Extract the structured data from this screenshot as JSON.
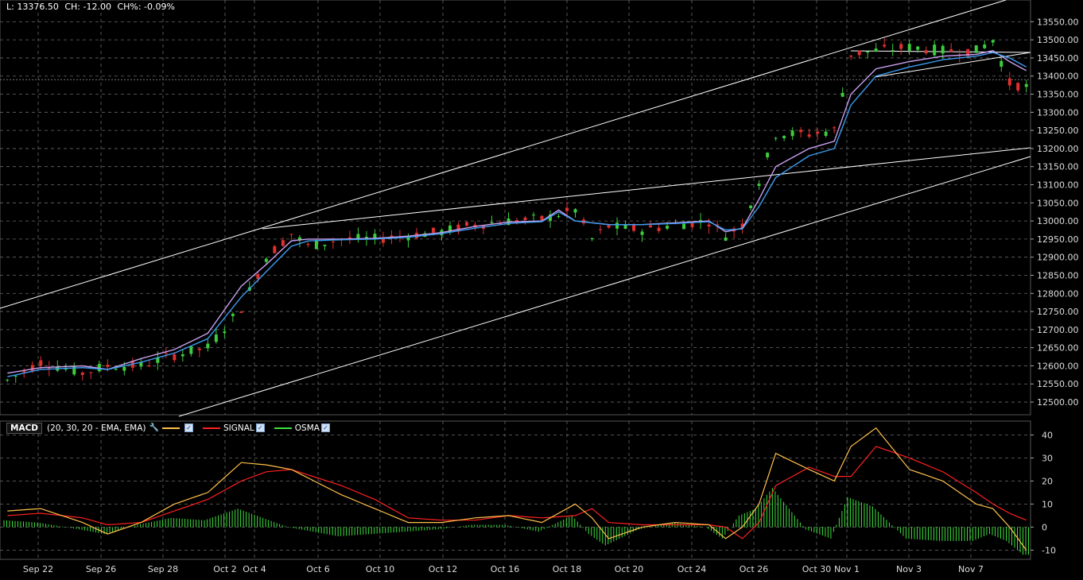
{
  "header": {
    "last_label": "L: 13376.50",
    "change_label": "CH: -12.00",
    "change_pct_label": "CH%: -0.09%"
  },
  "macd_legend": {
    "title": "MACD",
    "params": "(20, 30, 20 - EMA, EMA)",
    "signal_label": "SIGNAL",
    "osma_label": "OSMA",
    "macd_color": "#ffc04a",
    "signal_color": "#ff2020",
    "osma_color": "#3de03d"
  },
  "colors": {
    "background": "#000000",
    "grid": "#6a6a6a",
    "candle_up": "#3ccc3c",
    "candle_down": "#e03030",
    "ema_fast": "#c8a0f0",
    "ema_slow": "#3c9cf0",
    "trendline": "#ffffff"
  },
  "x_labels": [
    "Sep 22",
    "Sep 26",
    "Sep 28",
    "Oct 2",
    "Oct 4",
    "Oct 6",
    "Oct 10",
    "Oct 12",
    "Oct 16",
    "Oct 18",
    "Oct 20",
    "Oct 24",
    "Oct 26",
    "Oct 30",
    "Nov 1",
    "Nov 3",
    "Nov 7"
  ],
  "chart_data": [
    {
      "type": "candlestick",
      "title": "",
      "y_ticks": [
        12500,
        12550,
        12600,
        12650,
        12700,
        12750,
        12800,
        12850,
        12900,
        12950,
        13000,
        13050,
        13100,
        13150,
        13200,
        13250,
        13300,
        13350,
        13400,
        13450,
        13500,
        13550
      ],
      "ylim": [
        12465,
        13610
      ],
      "current_price_line": 13390,
      "price_path": [
        [
          0,
          12560
        ],
        [
          4,
          12610
        ],
        [
          9,
          12580
        ],
        [
          12,
          12600
        ],
        [
          16,
          12600
        ],
        [
          20,
          12630
        ],
        [
          24,
          12650
        ],
        [
          28,
          12760
        ],
        [
          31,
          12900
        ],
        [
          34,
          12965
        ],
        [
          36,
          12930
        ],
        [
          40,
          12950
        ],
        [
          44,
          12950
        ],
        [
          48,
          12960
        ],
        [
          52,
          12970
        ],
        [
          56,
          12990
        ],
        [
          60,
          13000
        ],
        [
          64,
          13005
        ],
        [
          68,
          13030
        ],
        [
          70,
          12950
        ],
        [
          72,
          12985
        ],
        [
          76,
          12975
        ],
        [
          80,
          12990
        ],
        [
          84,
          13000
        ],
        [
          86,
          12960
        ],
        [
          88,
          12990
        ],
        [
          90,
          13110
        ],
        [
          92,
          13240
        ],
        [
          96,
          13240
        ],
        [
          99,
          13250
        ],
        [
          101,
          13460
        ],
        [
          104,
          13470
        ],
        [
          108,
          13480
        ],
        [
          112,
          13470
        ],
        [
          116,
          13470
        ],
        [
          118,
          13500
        ],
        [
          120,
          13380
        ],
        [
          122,
          13370
        ]
      ],
      "ema_fast_path": [
        [
          0,
          12580
        ],
        [
          4,
          12595
        ],
        [
          9,
          12600
        ],
        [
          12,
          12590
        ],
        [
          16,
          12620
        ],
        [
          20,
          12645
        ],
        [
          24,
          12690
        ],
        [
          28,
          12820
        ],
        [
          31,
          12880
        ],
        [
          34,
          12945
        ],
        [
          36,
          12950
        ],
        [
          40,
          12950
        ],
        [
          44,
          12952
        ],
        [
          48,
          12958
        ],
        [
          52,
          12968
        ],
        [
          56,
          12985
        ],
        [
          60,
          12997
        ],
        [
          64,
          13000
        ],
        [
          66,
          13030
        ],
        [
          68,
          13000
        ],
        [
          72,
          12990
        ],
        [
          76,
          12990
        ],
        [
          80,
          12995
        ],
        [
          84,
          13000
        ],
        [
          86,
          12970
        ],
        [
          88,
          12980
        ],
        [
          90,
          13060
        ],
        [
          92,
          13150
        ],
        [
          96,
          13200
        ],
        [
          99,
          13220
        ],
        [
          101,
          13350
        ],
        [
          104,
          13420
        ],
        [
          108,
          13440
        ],
        [
          112,
          13455
        ],
        [
          116,
          13460
        ],
        [
          118,
          13470
        ],
        [
          120,
          13440
        ],
        [
          122,
          13415
        ]
      ],
      "ema_slow_path": [
        [
          0,
          12570
        ],
        [
          4,
          12590
        ],
        [
          9,
          12595
        ],
        [
          12,
          12590
        ],
        [
          16,
          12610
        ],
        [
          20,
          12635
        ],
        [
          24,
          12675
        ],
        [
          28,
          12790
        ],
        [
          31,
          12860
        ],
        [
          34,
          12930
        ],
        [
          36,
          12945
        ],
        [
          40,
          12948
        ],
        [
          44,
          12950
        ],
        [
          48,
          12955
        ],
        [
          52,
          12965
        ],
        [
          56,
          12980
        ],
        [
          60,
          12993
        ],
        [
          64,
          12998
        ],
        [
          66,
          13025
        ],
        [
          68,
          13000
        ],
        [
          72,
          12990
        ],
        [
          76,
          12990
        ],
        [
          80,
          12993
        ],
        [
          84,
          12998
        ],
        [
          86,
          12975
        ],
        [
          88,
          12978
        ],
        [
          90,
          13040
        ],
        [
          92,
          13120
        ],
        [
          96,
          13180
        ],
        [
          99,
          13200
        ],
        [
          101,
          13320
        ],
        [
          104,
          13400
        ],
        [
          108,
          13425
        ],
        [
          112,
          13445
        ],
        [
          116,
          13455
        ],
        [
          118,
          13465
        ],
        [
          120,
          13450
        ],
        [
          122,
          13425
        ]
      ]
    },
    {
      "type": "line",
      "title": "MACD",
      "y_ticks": [
        40,
        30,
        20,
        10,
        0,
        -10
      ],
      "ylim": [
        -14,
        46
      ],
      "macd_path": [
        [
          0,
          7
        ],
        [
          4,
          8
        ],
        [
          9,
          2
        ],
        [
          12,
          -3
        ],
        [
          16,
          2
        ],
        [
          20,
          10
        ],
        [
          24,
          15
        ],
        [
          28,
          28
        ],
        [
          31,
          27
        ],
        [
          34,
          25
        ],
        [
          40,
          14
        ],
        [
          44,
          8
        ],
        [
          48,
          2
        ],
        [
          52,
          2
        ],
        [
          56,
          4
        ],
        [
          60,
          5
        ],
        [
          64,
          2
        ],
        [
          68,
          10
        ],
        [
          70,
          4
        ],
        [
          72,
          -5
        ],
        [
          76,
          0
        ],
        [
          80,
          2
        ],
        [
          84,
          1
        ],
        [
          86,
          -5
        ],
        [
          88,
          0
        ],
        [
          90,
          10
        ],
        [
          92,
          32
        ],
        [
          96,
          25
        ],
        [
          99,
          20
        ],
        [
          101,
          35
        ],
        [
          104,
          43
        ],
        [
          108,
          25
        ],
        [
          112,
          20
        ],
        [
          116,
          10
        ],
        [
          118,
          8
        ],
        [
          120,
          0
        ],
        [
          122,
          -10
        ]
      ],
      "signal_path": [
        [
          0,
          5
        ],
        [
          4,
          6
        ],
        [
          9,
          4
        ],
        [
          12,
          1
        ],
        [
          16,
          2
        ],
        [
          20,
          7
        ],
        [
          24,
          12
        ],
        [
          28,
          20
        ],
        [
          31,
          24
        ],
        [
          34,
          25
        ],
        [
          40,
          18
        ],
        [
          44,
          12
        ],
        [
          48,
          4
        ],
        [
          52,
          3
        ],
        [
          56,
          3
        ],
        [
          60,
          5
        ],
        [
          64,
          4
        ],
        [
          68,
          5
        ],
        [
          70,
          8
        ],
        [
          72,
          2
        ],
        [
          76,
          1
        ],
        [
          80,
          1
        ],
        [
          84,
          1
        ],
        [
          86,
          0
        ],
        [
          88,
          -5
        ],
        [
          90,
          2
        ],
        [
          92,
          18
        ],
        [
          96,
          26
        ],
        [
          99,
          22
        ],
        [
          101,
          22
        ],
        [
          104,
          35
        ],
        [
          108,
          30
        ],
        [
          112,
          24
        ],
        [
          116,
          15
        ],
        [
          118,
          10
        ],
        [
          120,
          6
        ],
        [
          122,
          3
        ]
      ],
      "osma_path": [
        [
          0,
          3
        ],
        [
          4,
          2
        ],
        [
          9,
          -1
        ],
        [
          12,
          -3
        ],
        [
          16,
          1
        ],
        [
          20,
          4
        ],
        [
          24,
          3
        ],
        [
          28,
          8
        ],
        [
          31,
          4
        ],
        [
          34,
          0
        ],
        [
          40,
          -4
        ],
        [
          44,
          -3
        ],
        [
          48,
          -2
        ],
        [
          52,
          -1
        ],
        [
          56,
          1
        ],
        [
          60,
          1
        ],
        [
          64,
          -2
        ],
        [
          68,
          5
        ],
        [
          70,
          -3
        ],
        [
          72,
          -8
        ],
        [
          76,
          -1
        ],
        [
          80,
          2
        ],
        [
          84,
          0
        ],
        [
          86,
          -5
        ],
        [
          88,
          5
        ],
        [
          90,
          8
        ],
        [
          92,
          17
        ],
        [
          96,
          -1
        ],
        [
          99,
          -5
        ],
        [
          101,
          13
        ],
        [
          104,
          9
        ],
        [
          108,
          -5
        ],
        [
          112,
          -6
        ],
        [
          116,
          -6
        ],
        [
          118,
          -3
        ],
        [
          120,
          -6
        ],
        [
          122,
          -12
        ]
      ]
    }
  ]
}
